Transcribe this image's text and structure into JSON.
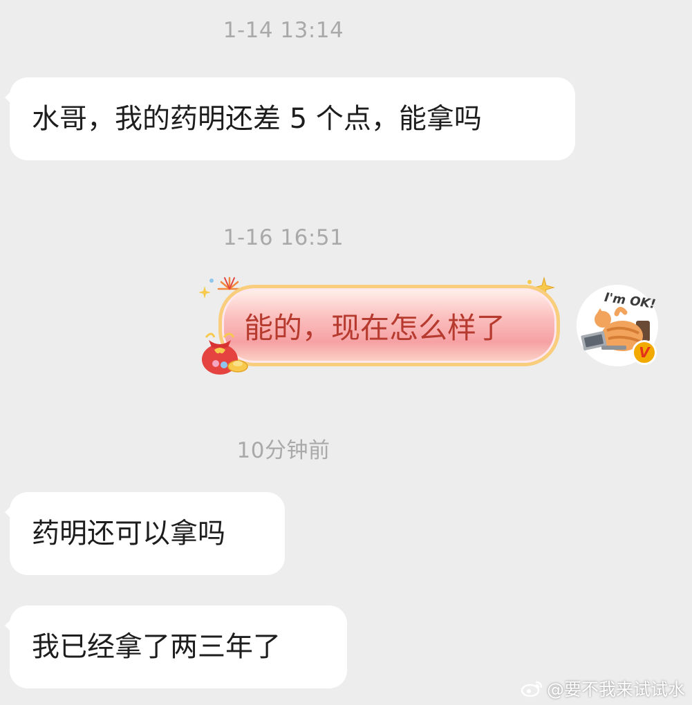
{
  "timestamps": [
    "1-14 13:14",
    "1-16 16:51",
    "10分钟前"
  ],
  "messages": [
    {
      "text": "水哥，我的药明还差 5 个点，能拿吗"
    },
    {
      "text": "能的，现在怎么样了"
    },
    {
      "text": "药明还可以拿吗"
    },
    {
      "text": "我已经拿了两三年了"
    }
  ],
  "avatar": {
    "sticker_text": "I'm OK!",
    "badge": "V",
    "icon": "cat-laptop-avatar-icon"
  },
  "watermark": {
    "text": "@要不我来试试水",
    "icon": "weibo-logo-icon"
  },
  "colors": {
    "background": "#ededed",
    "incoming_bubble": "#ffffff",
    "outgoing_text": "#b63a2e",
    "outgoing_border": "#f8cd7c",
    "timestamp": "#a9a9a9",
    "badge": "#f2a900"
  }
}
